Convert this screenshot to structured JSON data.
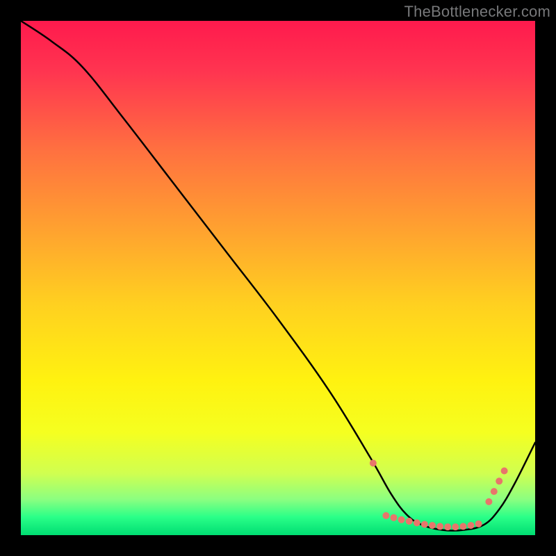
{
  "watermark": "TheBottlenecker.com",
  "chart_data": {
    "type": "line",
    "title": "",
    "xlabel": "",
    "ylabel": "",
    "xlim": [
      0,
      100
    ],
    "ylim": [
      0,
      100
    ],
    "grid": false,
    "gradient_stops": [
      {
        "offset": 0.0,
        "color": "#ff1a4d"
      },
      {
        "offset": 0.1,
        "color": "#ff3550"
      },
      {
        "offset": 0.25,
        "color": "#ff7040"
      },
      {
        "offset": 0.4,
        "color": "#ffa030"
      },
      {
        "offset": 0.55,
        "color": "#ffd020"
      },
      {
        "offset": 0.7,
        "color": "#fff210"
      },
      {
        "offset": 0.8,
        "color": "#f5ff20"
      },
      {
        "offset": 0.88,
        "color": "#d0ff50"
      },
      {
        "offset": 0.93,
        "color": "#8cff80"
      },
      {
        "offset": 0.965,
        "color": "#2aff88"
      },
      {
        "offset": 1.0,
        "color": "#00dd72"
      }
    ],
    "series": [
      {
        "name": "bottleneck-curve",
        "x": [
          0,
          6,
          12,
          20,
          30,
          40,
          50,
          60,
          68,
          72,
          75,
          78,
          82,
          86,
          90,
          93,
          96,
          100
        ],
        "y": [
          100,
          96,
          91,
          81,
          68,
          55,
          42,
          28,
          15,
          8,
          4,
          2,
          1,
          1,
          2,
          5,
          10,
          18
        ]
      }
    ],
    "markers": {
      "name": "optimal-range-dots",
      "color": "#e8756b",
      "radius": 5,
      "points": [
        {
          "x": 68.5,
          "y": 14
        },
        {
          "x": 71,
          "y": 3.8
        },
        {
          "x": 72.5,
          "y": 3.4
        },
        {
          "x": 74,
          "y": 3.0
        },
        {
          "x": 75.5,
          "y": 2.7
        },
        {
          "x": 77,
          "y": 2.4
        },
        {
          "x": 78.5,
          "y": 2.1
        },
        {
          "x": 80,
          "y": 1.9
        },
        {
          "x": 81.5,
          "y": 1.7
        },
        {
          "x": 83,
          "y": 1.6
        },
        {
          "x": 84.5,
          "y": 1.6
        },
        {
          "x": 86,
          "y": 1.7
        },
        {
          "x": 87.5,
          "y": 1.9
        },
        {
          "x": 89,
          "y": 2.2
        },
        {
          "x": 91,
          "y": 6.5
        },
        {
          "x": 92,
          "y": 8.5
        },
        {
          "x": 93,
          "y": 10.5
        },
        {
          "x": 94,
          "y": 12.5
        }
      ]
    }
  }
}
